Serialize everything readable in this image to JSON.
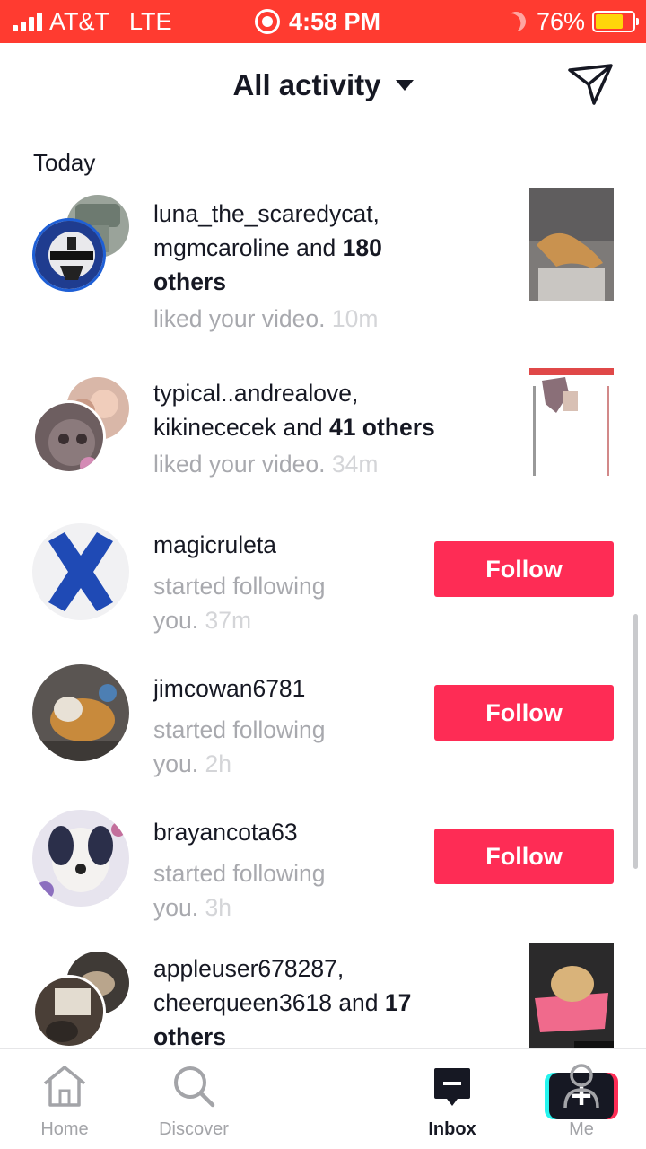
{
  "status_bar": {
    "carrier": "AT&T",
    "network": "LTE",
    "time": "4:58 PM",
    "battery_percent": "76%",
    "battery_level": 0.76,
    "background_color": "#ff3b30"
  },
  "header": {
    "title": "All activity",
    "icons": [
      "caret-down-icon",
      "send-icon"
    ]
  },
  "section": {
    "label": "Today"
  },
  "activities": [
    {
      "user1": "luna_the_scaredycat,",
      "user2": "mgmcaroline",
      "connector": "and",
      "others": "180",
      "others_label": "others",
      "action": "liked your video.",
      "time": "10m"
    },
    {
      "user1": "typical..andrealove,",
      "user2": "kikinececek",
      "connector": "and",
      "others": "41 others",
      "action": "liked your video.",
      "time": "34m"
    },
    {
      "username": "magicruleta",
      "action_line1": "started following",
      "action_line2": "you.",
      "time": "37m",
      "button": "Follow"
    },
    {
      "username": "jimcowan6781",
      "action_line1": "started following",
      "action_line2": "you.",
      "time": "2h",
      "button": "Follow"
    },
    {
      "username": "brayancota63",
      "action_line1": "started following",
      "action_line2": "you.",
      "time": "3h",
      "button": "Follow"
    },
    {
      "user1": "appleuser678287,",
      "user2": "cheerqueen3618",
      "connector": "and",
      "others": "17",
      "others_label": "others"
    }
  ],
  "tabbar": {
    "tabs": [
      {
        "label": "Home",
        "icon": "home-icon"
      },
      {
        "label": "Discover",
        "icon": "search-icon"
      },
      {
        "label": "",
        "icon": "create-plus-icon"
      },
      {
        "label": "Inbox",
        "icon": "inbox-icon",
        "active": true
      },
      {
        "label": "Me",
        "icon": "profile-icon"
      }
    ],
    "create_symbol": "+"
  },
  "colors": {
    "accent": "#fe2c55",
    "text": "#161823",
    "muted": "#a8a9ae",
    "cyan": "#25f4ee"
  }
}
